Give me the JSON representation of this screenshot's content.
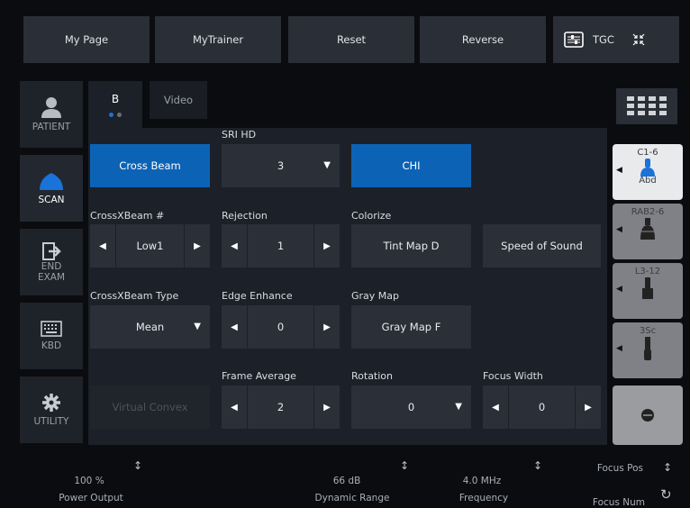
{
  "topbar": {
    "my_page": "My Page",
    "mytrainer": "MyTrainer",
    "reset": "Reset",
    "reverse": "Reverse",
    "tgc": "TGC"
  },
  "tabs": {
    "b": "B",
    "video": "Video"
  },
  "sidebar": {
    "patient": "PATIENT",
    "scan": "SCAN",
    "end_exam_1": "END",
    "end_exam_2": "EXAM",
    "kbd": "KBD",
    "utility": "UTILITY"
  },
  "controls": {
    "sri_hd_label": "SRI HD",
    "sri_hd_value": "3",
    "cross_beam": "Cross Beam",
    "chi": "CHI",
    "crossxbeam_label": "CrossXBeam #",
    "crossxbeam_value": "Low1",
    "rejection_label": "Rejection",
    "rejection_value": "1",
    "colorize_label": "Colorize",
    "tint_map": "Tint Map D",
    "speed_of_sound": "Speed of Sound",
    "crossxbeam_type_label": "CrossXBeam Type",
    "crossxbeam_type_value": "Mean",
    "edge_enhance_label": "Edge Enhance",
    "edge_enhance_value": "0",
    "gray_map_label": "Gray Map",
    "gray_map_value": "Gray Map F",
    "virtual_convex": "Virtual Convex",
    "frame_average_label": "Frame Average",
    "frame_average_value": "2",
    "rotation_label": "Rotation",
    "rotation_value": "0",
    "focus_width_label": "Focus Width",
    "focus_width_value": "0"
  },
  "probes": [
    {
      "name": "C1-6",
      "sub": "Abd",
      "active": true
    },
    {
      "name": "RAB2-6",
      "sub": "",
      "active": false
    },
    {
      "name": "L3-12",
      "sub": "",
      "active": false
    },
    {
      "name": "3Sc",
      "sub": "",
      "active": false
    }
  ],
  "footer": {
    "power_output_value": "100 %",
    "power_output_label": "Power Output",
    "dynamic_range_value": "66 dB",
    "dynamic_range_label": "Dynamic Range",
    "frequency_value": "4.0 MHz",
    "frequency_label": "Frequency",
    "focus_pos": "Focus Pos",
    "focus_num": "Focus Num"
  },
  "colors": {
    "accent": "#0c63b6",
    "panel": "#1c2028",
    "background": "#0b0c0f"
  }
}
